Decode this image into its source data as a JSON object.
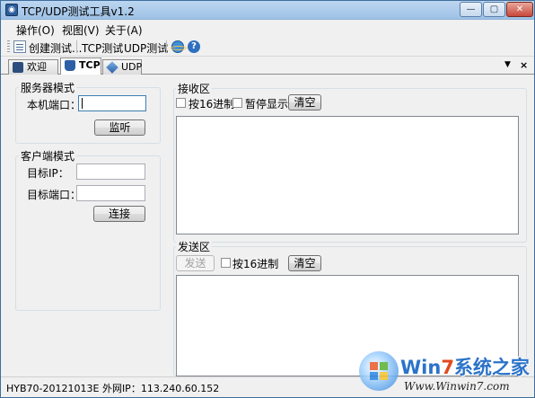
{
  "window": {
    "title": "TCP/UDP测试工具v1.2",
    "minimize": "—",
    "maximize": "▢",
    "close": "✕"
  },
  "menu": [
    "操作(O)",
    "视图(V)",
    "关于(A)"
  ],
  "toolbar": {
    "create": "创建测试...",
    "tcp": "TCP测试",
    "udp": "UDP测试",
    "icons": [
      "create-test-icon",
      "ie-icon",
      "help-icon"
    ]
  },
  "tabs": [
    {
      "label": "欢迎",
      "icon": "welcome-icon"
    },
    {
      "label": "TCP",
      "icon": "tcp-icon",
      "active": true
    },
    {
      "label": "UDP",
      "icon": "udp-icon"
    }
  ],
  "tab_controls": {
    "menu": "▼",
    "close": "×"
  },
  "server": {
    "title": "服务器模式",
    "port_label": "本机端口：",
    "port_value": "",
    "listen_button": "监听"
  },
  "client": {
    "title": "客户端模式",
    "ip_label": "目标IP：",
    "ip_value": "",
    "port_label": "目标端口：",
    "port_value": "",
    "connect_button": "连接"
  },
  "receive": {
    "title": "接收区",
    "hex_label": "按16进制",
    "pause_label": "暂停显示",
    "clear_button": "清空",
    "content": ""
  },
  "send": {
    "title": "发送区",
    "send_button": "发送",
    "hex_label": "按16进制",
    "clear_button": "清空",
    "content": ""
  },
  "status": {
    "text": "HYB70-20121013E  外网IP：113.240.60.152"
  },
  "watermark": {
    "title_a": "Win",
    "title_b": "7",
    "title_c": "系统之家",
    "url": "Www.Winwin7.com"
  }
}
